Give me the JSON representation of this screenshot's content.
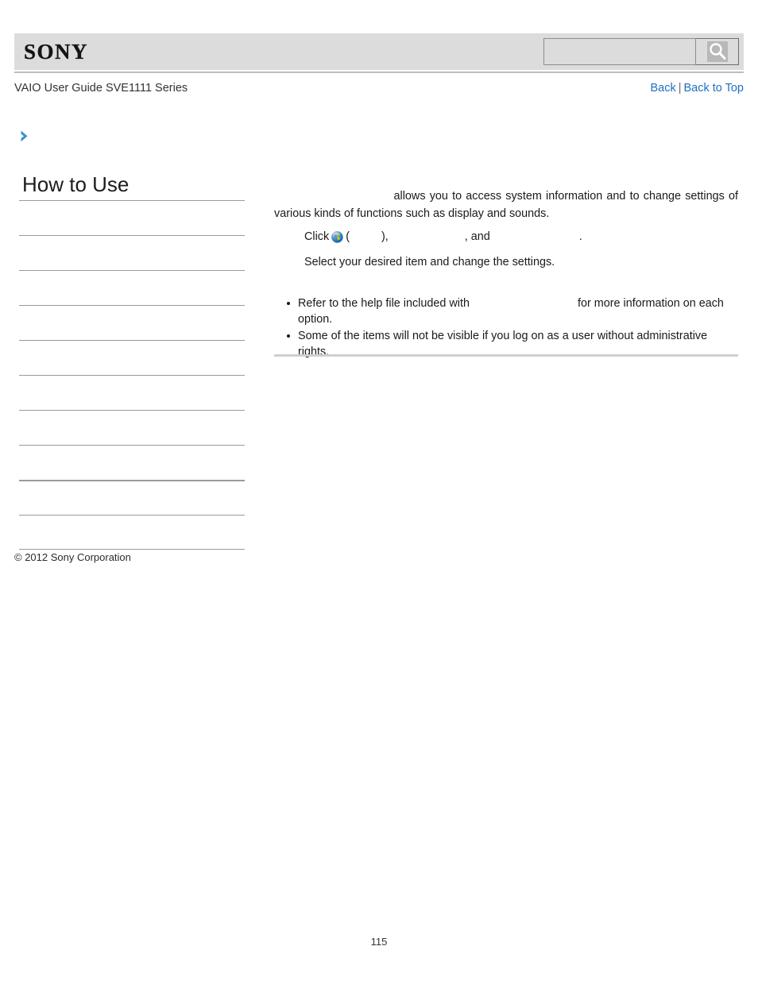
{
  "header": {
    "logo_text": "SONY",
    "search": {
      "value": "",
      "placeholder": "",
      "icon": "search-icon"
    }
  },
  "subheader": {
    "guide_title": "VAIO User Guide SVE1111 Series",
    "back_label": "Back",
    "separator": "|",
    "back_to_top_label": "Back to Top"
  },
  "breadcrumb": {
    "icon": "chevron-right-icon",
    "text": ""
  },
  "sidebar": {
    "title": "How to Use",
    "items": [
      {
        "label": ""
      },
      {
        "label": ""
      },
      {
        "label": ""
      },
      {
        "label": ""
      },
      {
        "label": ""
      },
      {
        "label": ""
      },
      {
        "label": ""
      },
      {
        "label": ""
      },
      {
        "label": ""
      },
      {
        "label": ""
      }
    ]
  },
  "main": {
    "intro": {
      "hidden_lead": "                             ",
      "text": "allows you to access system information and to change settings of various kinds of functions such as display and sounds."
    },
    "steps": [
      {
        "click_label": "Click",
        "icon": "windows-start-orb-icon",
        "open_paren": "(",
        "hidden_start": "          ",
        "close_paren": "),",
        "hidden_mid": "                        ",
        "and_label": ", and",
        "hidden_end": "                            ",
        "period": "."
      },
      {
        "text": "Select your desired item and change the settings."
      }
    ],
    "notes": [
      {
        "prefix": "Refer to the help file included with",
        "hidden_term": "                                  ",
        "suffix": "for more information on each option."
      },
      {
        "prefix": "Some of the items will not be visible if you log on as a user without administrative rights.",
        "hidden_term": "",
        "suffix": ""
      }
    ]
  },
  "footer": {
    "copyright": "© 2012 Sony Corporation",
    "page_number": "115"
  },
  "colors": {
    "header_band": "#dcdcdc",
    "link": "#1f6fc4",
    "accent_chevron": "#3c8fd0",
    "rule": "#9a9a9a"
  }
}
